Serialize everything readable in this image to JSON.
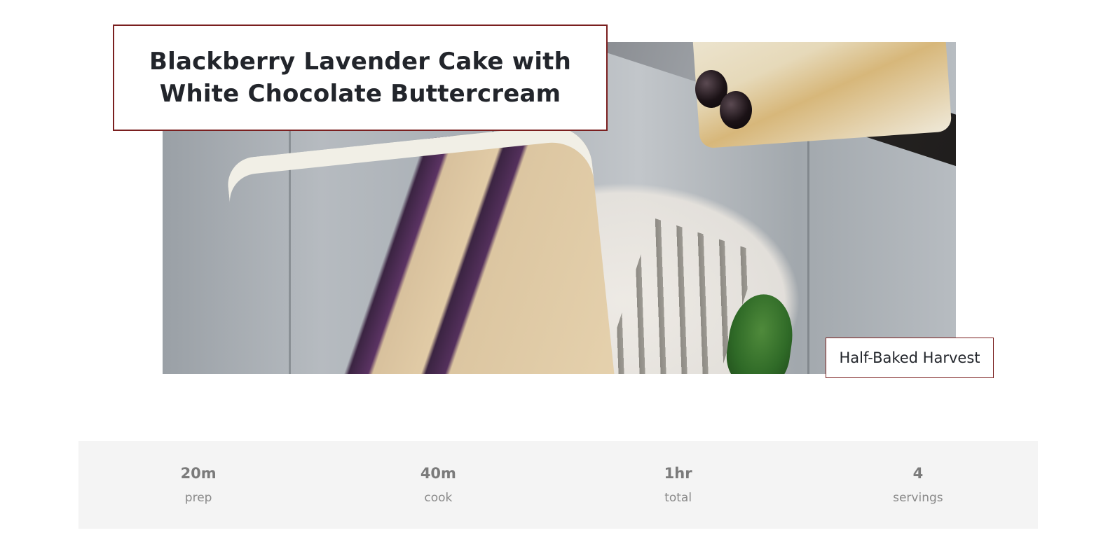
{
  "recipe": {
    "title": "Blackberry Lavender Cake with White Chocolate Buttercream",
    "source": "Half-Baked Harvest",
    "image_alt": "Blackberry lavender cake slice on a plate with a fork"
  },
  "stats": [
    {
      "value": "20m",
      "label": "prep"
    },
    {
      "value": "40m",
      "label": "cook"
    },
    {
      "value": "1hr",
      "label": "total"
    },
    {
      "value": "4",
      "label": "servings"
    }
  ],
  "colors": {
    "accent_border": "#7a1f1f",
    "stats_background": "#f4f4f4",
    "stat_text": "#7b7b7b",
    "title_text": "#22252b"
  }
}
